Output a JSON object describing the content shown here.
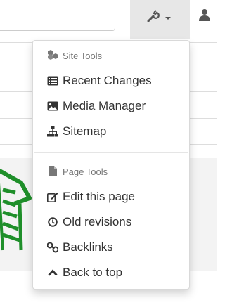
{
  "site_tools": {
    "header": "Site Tools",
    "header_icon": "cubes-icon",
    "items": [
      {
        "label": "Recent Changes",
        "icon": "list-alt-icon"
      },
      {
        "label": "Media Manager",
        "icon": "image-icon"
      },
      {
        "label": "Sitemap",
        "icon": "sitemap-icon"
      }
    ]
  },
  "page_tools": {
    "header": "Page Tools",
    "header_icon": "file-icon",
    "items": [
      {
        "label": "Edit this page",
        "icon": "edit-icon"
      },
      {
        "label": "Old revisions",
        "icon": "clock-icon"
      },
      {
        "label": "Backlinks",
        "icon": "link-icon"
      },
      {
        "label": "Back to top",
        "icon": "chevron-up-icon"
      }
    ]
  },
  "colors": {
    "menu_text": "#333333",
    "header_text": "#777777",
    "toggle_bg": "#e7e7e7",
    "logo_green": "#1f8f2a"
  }
}
